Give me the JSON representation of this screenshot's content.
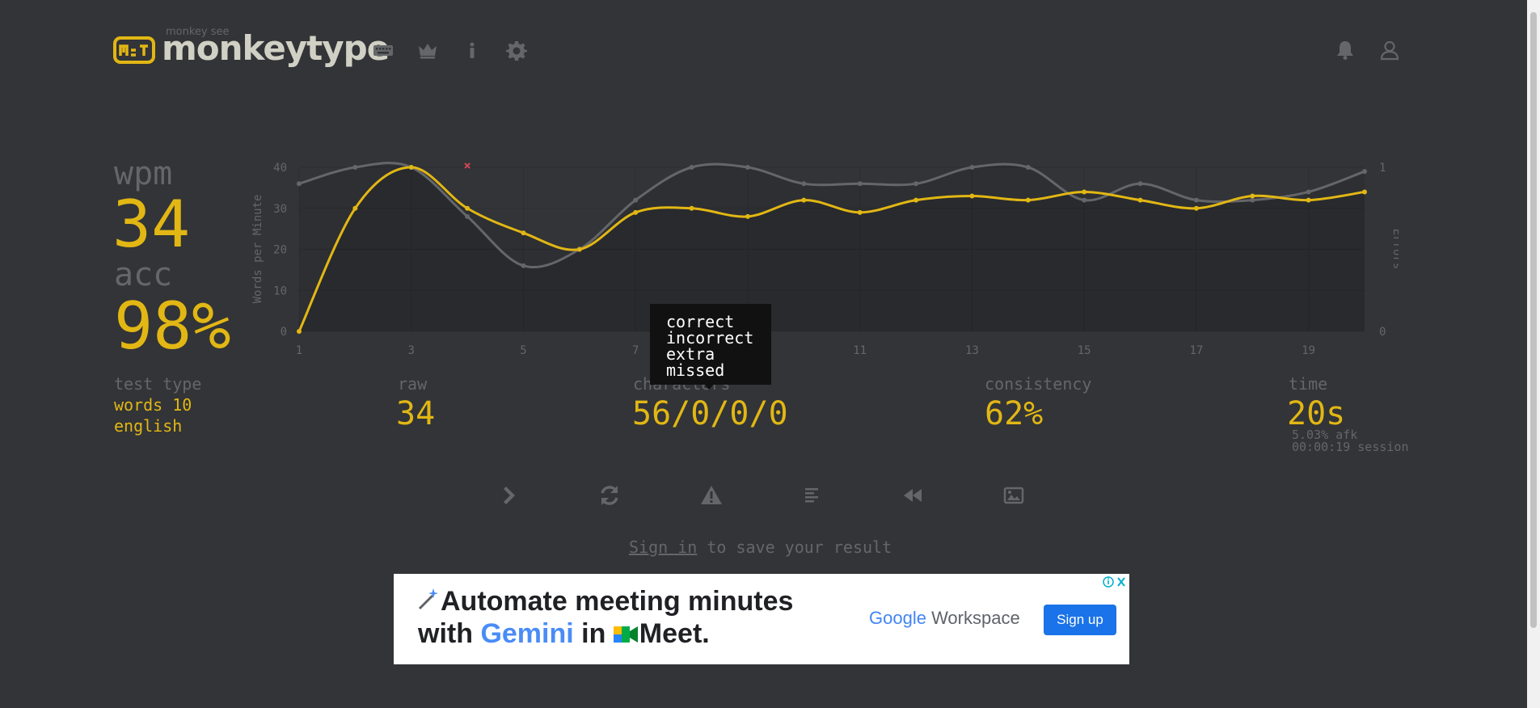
{
  "header": {
    "brand_sub": "monkey see",
    "brand": "monkeytype",
    "nav": [
      "keyboard-icon",
      "crown-icon",
      "info-icon",
      "gear-icon"
    ],
    "right": [
      "bell-icon",
      "user-icon"
    ]
  },
  "stats": {
    "wpm_label": "wpm",
    "wpm_value": "34",
    "acc_label": "acc",
    "acc_value": "98%",
    "test_type_label": "test type",
    "test_type_mode": "words 10",
    "test_type_lang": "english",
    "raw_label": "raw",
    "raw_value": "34",
    "characters_label": "characters",
    "characters_value": "56/0/0/0",
    "consistency_label": "consistency",
    "consistency_value": "62%",
    "time_label": "time",
    "time_value": "20s",
    "afk": "5.03% afk",
    "session": "00:00:19 session"
  },
  "tooltip": [
    "correct",
    "incorrect",
    "extra",
    "missed"
  ],
  "actions": [
    "next-test-icon",
    "restart-icon",
    "report-icon",
    "words-history-icon",
    "replay-icon",
    "screenshot-icon"
  ],
  "signin": {
    "link": "Sign in",
    "rest": " to save your result"
  },
  "ad": {
    "line1": "Automate meeting minutes",
    "line2_pre": "with ",
    "line2_gemini": "Gemini",
    "line2_mid": " in ",
    "line2_meet": "Meet.",
    "brand_google": "Google",
    "brand_workspace": " Workspace",
    "signup": "Sign up"
  },
  "colors": {
    "bg": "#323437",
    "main": "#e2b714",
    "sub": "#646669",
    "text": "#d1d0c5",
    "error": "#ca4754"
  },
  "chart_data": {
    "type": "line",
    "x": [
      1,
      2,
      3,
      4,
      5,
      6,
      7,
      8,
      9,
      10,
      11,
      12,
      13,
      14,
      15,
      16,
      17,
      18,
      19,
      20
    ],
    "x_ticks": [
      1,
      3,
      5,
      7,
      9,
      11,
      13,
      15,
      17,
      19
    ],
    "y_ticks": [
      0,
      10,
      20,
      30,
      40
    ],
    "ylabel": "Words per Minute",
    "y2label": "Errors",
    "ylim": [
      0,
      40
    ],
    "y2lim": [
      0,
      1
    ],
    "y2_ticks": [
      0,
      1
    ],
    "series": [
      {
        "name": "wpm",
        "color": "#e2b714",
        "values": [
          0,
          30,
          40,
          30,
          24,
          20,
          29,
          30,
          28,
          32,
          29,
          32,
          33,
          32,
          34,
          32,
          30,
          33,
          32,
          34
        ]
      },
      {
        "name": "raw",
        "color": "#646669",
        "values": [
          36,
          40,
          40,
          28,
          16,
          20,
          32,
          40,
          40,
          36,
          36,
          36,
          40,
          40,
          32,
          36,
          32,
          32,
          34,
          39
        ]
      }
    ],
    "errors": [
      {
        "x": 4,
        "value": 1
      }
    ],
    "grid": true
  }
}
